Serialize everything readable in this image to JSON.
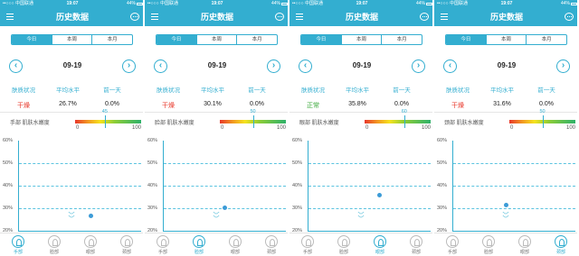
{
  "phones": [
    {
      "carrier": "••○○○ 中国联通 ",
      "time": "19:07",
      "battery": "44%",
      "nav_title": "历史数据",
      "tabs": [
        "今日",
        "本周",
        "本月"
      ],
      "active_tab": 0,
      "date": "09-19",
      "stat_labels": [
        "肤质状况",
        "平均水平",
        "前一天"
      ],
      "skin_status": "干燥",
      "avg": "26.7%",
      "prev": "0.0%",
      "region_label": "手部 肌肤水嫩度",
      "marker_value": "45",
      "scale_min": "0",
      "scale_max": "100",
      "y_labels": [
        "60%",
        "50%",
        "40%",
        "30%",
        "20%"
      ],
      "point_value": 26.7,
      "bottom": [
        "手部",
        "脸部",
        "眼部",
        "颈部"
      ],
      "active_bottom": 0
    },
    {
      "carrier": "••○○○ 中国联通 ",
      "time": "19:07",
      "battery": "44%",
      "nav_title": "历史数据",
      "tabs": [
        "今日",
        "本周",
        "本月"
      ],
      "active_tab": 0,
      "date": "09-19",
      "stat_labels": [
        "肤质状况",
        "平均水平",
        "前一天"
      ],
      "skin_status": "干燥",
      "avg": "30.1%",
      "prev": "0.0%",
      "region_label": "脸部 肌肤水嫩度",
      "marker_value": "50",
      "scale_min": "0",
      "scale_max": "100",
      "y_labels": [
        "60%",
        "50%",
        "40%",
        "30%",
        "20%"
      ],
      "point_value": 30.1,
      "bottom": [
        "手部",
        "脸部",
        "眼部",
        "颈部"
      ],
      "active_bottom": 1
    },
    {
      "carrier": "••○○○ 中国联通 ",
      "time": "19:07",
      "battery": "44%",
      "nav_title": "历史数据",
      "tabs": [
        "今日",
        "本周",
        "本月"
      ],
      "active_tab": 0,
      "date": "09-19",
      "stat_labels": [
        "肤质状况",
        "平均水平",
        "前一天"
      ],
      "skin_status": "正常",
      "avg": "35.8%",
      "prev": "0.0%",
      "region_label": "眼部 肌肤水嫩度",
      "marker_value": "60",
      "scale_min": "0",
      "scale_max": "100",
      "y_labels": [
        "60%",
        "50%",
        "40%",
        "30%",
        "20%"
      ],
      "point_value": 35.8,
      "bottom": [
        "手部",
        "脸部",
        "眼部",
        "颈部"
      ],
      "active_bottom": 2
    },
    {
      "carrier": "••○○○ 中国联通 ",
      "time": "19:07",
      "battery": "44%",
      "nav_title": "历史数据",
      "tabs": [
        "今日",
        "本周",
        "本月"
      ],
      "active_tab": 0,
      "date": "09-19",
      "stat_labels": [
        "肤质状况",
        "平均水平",
        "前一天"
      ],
      "skin_status": "干燥",
      "avg": "31.6%",
      "prev": "0.0%",
      "region_label": "颈部 肌肤水嫩度",
      "marker_value": "50",
      "scale_min": "0",
      "scale_max": "100",
      "y_labels": [
        "60%",
        "50%",
        "40%",
        "30%",
        "20%"
      ],
      "point_value": 31.6,
      "bottom": [
        "手部",
        "脸部",
        "眼部",
        "颈部"
      ],
      "active_bottom": 3
    }
  ],
  "colors": {
    "accent": "#33aed0",
    "dry": "#e8382b",
    "normal": "#3aa83a",
    "point": "#3c9bd7"
  }
}
